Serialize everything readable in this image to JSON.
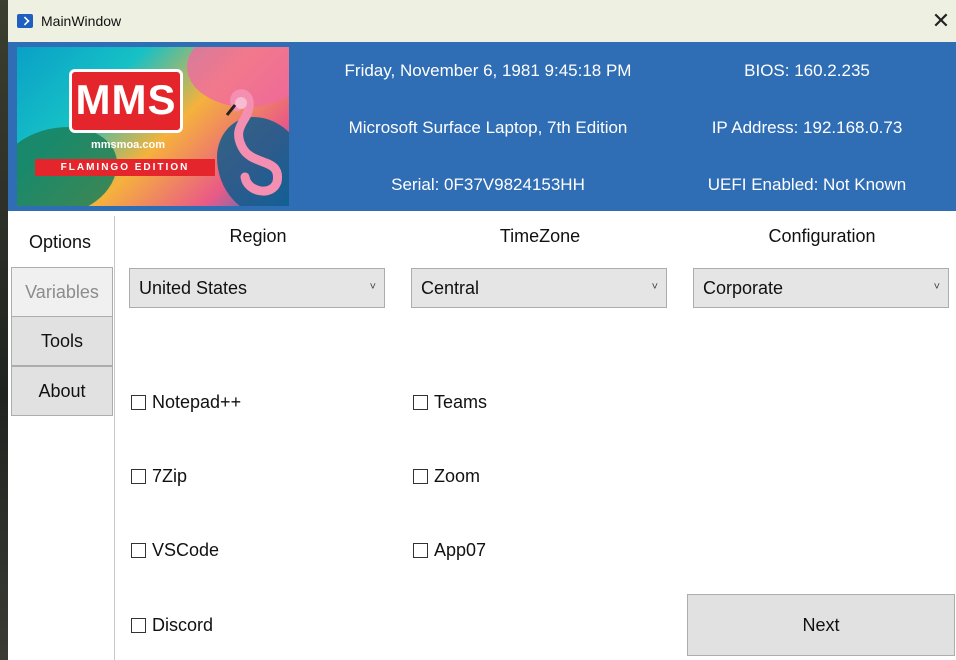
{
  "window": {
    "title": "MainWindow",
    "close_glyph": "✕"
  },
  "banner": {
    "logo_text": "MMS",
    "url": "mmsmoa.com",
    "edition": "FLAMINGO EDITION"
  },
  "header": {
    "datetime": "Friday, November 6, 1981 9:45:18 PM",
    "model": "Microsoft Surface Laptop, 7th Edition",
    "serial": "Serial: 0F37V9824153HH",
    "bios": "BIOS: 160.2.235",
    "ip": "IP Address: 192.168.0.73",
    "uefi": "UEFI Enabled: Not Known"
  },
  "nav": {
    "items": [
      {
        "label": "Options"
      },
      {
        "label": "Variables"
      },
      {
        "label": "Tools"
      },
      {
        "label": "About"
      }
    ]
  },
  "form": {
    "region": {
      "label": "Region",
      "value": "United States"
    },
    "timezone": {
      "label": "TimeZone",
      "value": "Central"
    },
    "configuration": {
      "label": "Configuration",
      "value": "Corporate"
    },
    "chevron": "˅",
    "apps": [
      {
        "label": "Notepad++",
        "checked": false
      },
      {
        "label": "7Zip",
        "checked": false
      },
      {
        "label": "VSCode",
        "checked": false
      },
      {
        "label": "Discord",
        "checked": false
      },
      {
        "label": "Teams",
        "checked": false
      },
      {
        "label": "Zoom",
        "checked": false
      },
      {
        "label": "App07",
        "checked": false
      }
    ],
    "next_label": "Next"
  },
  "colors": {
    "header_bg": "#2f6db5",
    "titlebar_bg": "#eef1e2",
    "button_bg": "#e1e1e1"
  }
}
